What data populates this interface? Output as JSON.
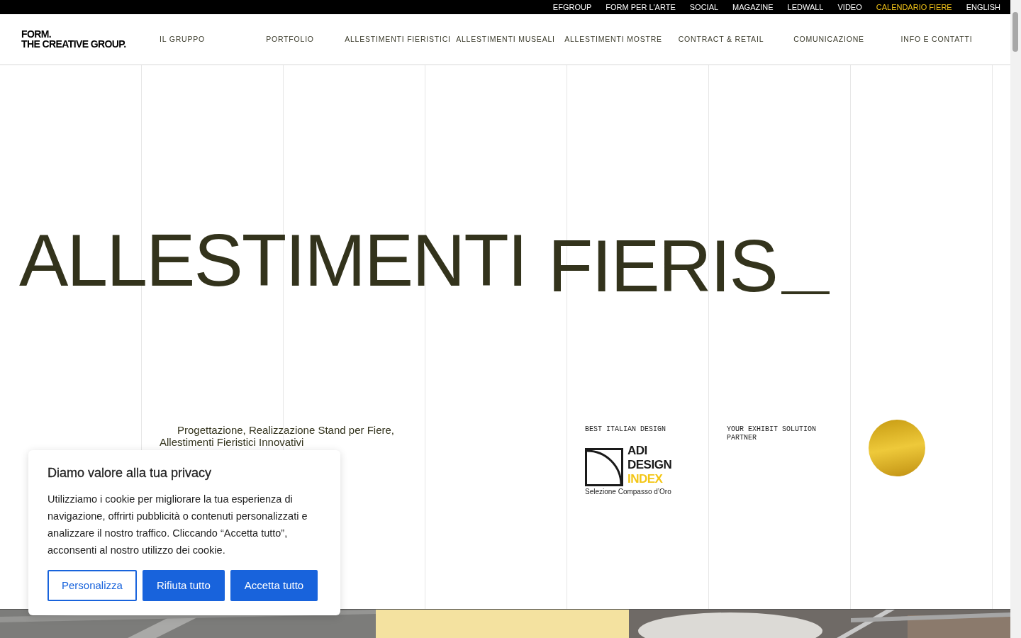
{
  "top_links": [
    {
      "label": "EFGROUP",
      "highlighted": false
    },
    {
      "label": "FORM PER L'ARTE",
      "highlighted": false
    },
    {
      "label": "SOCIAL",
      "highlighted": false
    },
    {
      "label": "MAGAZINE",
      "highlighted": false
    },
    {
      "label": "LEDWALL",
      "highlighted": false
    },
    {
      "label": "VIDEO",
      "highlighted": false
    },
    {
      "label": "CALENDARIO FIERE",
      "highlighted": true
    },
    {
      "label": "ENGLISH",
      "highlighted": false
    }
  ],
  "logo": {
    "line_1": "FORM.",
    "line_2": "THE CREATIVE GROUP."
  },
  "nav": [
    "IL GRUPPO",
    "PORTFOLIO",
    "ALLESTIMENTI FIERISTICI",
    "ALLESTIMENTI MUSEALI",
    "ALLESTIMENTI MOSTRE",
    "CONTRACT & RETAIL",
    "COMUNICAZIONE",
    "INFO E CONTATTI"
  ],
  "hero": {
    "title_words": [
      "ALLESTIMENTI",
      "FIERIS"
    ],
    "subtitle": "Progettazione, Realizzazione Stand per Fiere, Allestimenti Fieristici Innovativi",
    "badges": [
      {
        "kind": "adi_logo",
        "caption": "BEST ITALIAN DESIGN",
        "logo_lines": [
          "ADI",
          "DESIGN",
          "INDEX"
        ],
        "logo_caption": "Selezione Compasso d’Oro"
      },
      {
        "kind": "text",
        "caption": "YOUR EXHIBIT SOLUTION PARTNER"
      },
      {
        "kind": "gold_seal"
      }
    ]
  },
  "cookie_banner": {
    "title": "Diamo valore alla tua privacy",
    "text": "Utilizziamo i cookie per migliorare la tua esperienza di navigazione, offrirti pubblicità o contenuti personalizzati e analizzare il nostro traffico. Cliccando “Accetta tutto”, acconsenti al nostro utilizzo dei cookie.",
    "buttons": [
      {
        "label": "Personalizza",
        "kind": "outline"
      },
      {
        "label": "Rifiuta tutto",
        "kind": "filled"
      },
      {
        "label": "Accetta tutto",
        "kind": "filled"
      }
    ]
  }
}
